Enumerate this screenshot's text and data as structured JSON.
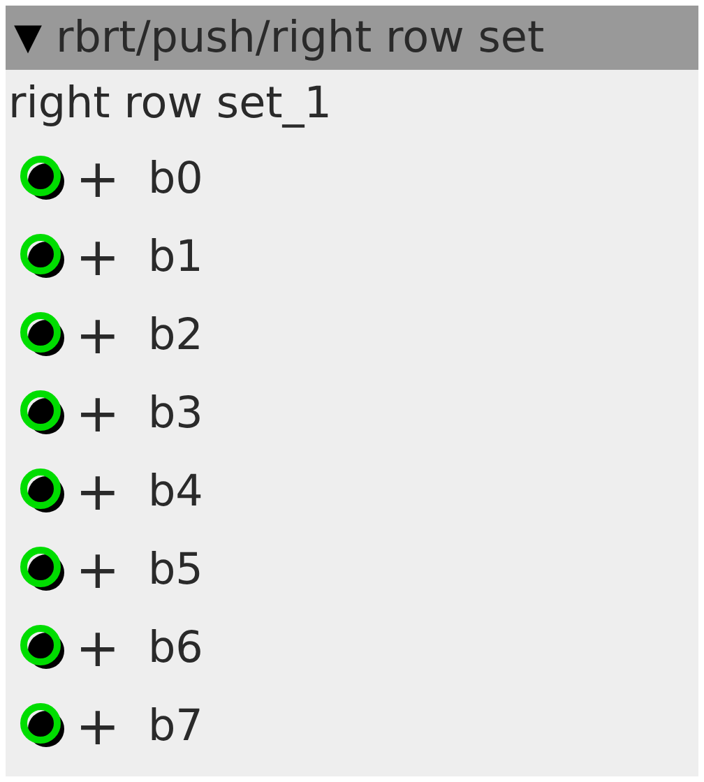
{
  "panel": {
    "toggle": "▼",
    "title": "rbrt/push/right row set",
    "expanded": true
  },
  "group": {
    "title": "right row set_1"
  },
  "items": [
    {
      "expander": "+",
      "label": "b0"
    },
    {
      "expander": "+",
      "label": "b1"
    },
    {
      "expander": "+",
      "label": "b2"
    },
    {
      "expander": "+",
      "label": "b3"
    },
    {
      "expander": "+",
      "label": "b4"
    },
    {
      "expander": "+",
      "label": "b5"
    },
    {
      "expander": "+",
      "label": "b6"
    },
    {
      "expander": "+",
      "label": "b7"
    }
  ]
}
